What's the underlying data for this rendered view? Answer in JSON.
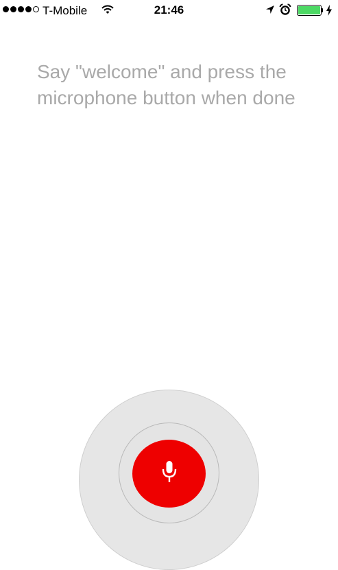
{
  "status_bar": {
    "signal_strength": 4,
    "signal_max": 5,
    "carrier": "T-Mobile",
    "time": "21:46",
    "battery_level": 1.0,
    "battery_color": "#4cd964",
    "icons": [
      "signal-dots-icon",
      "wifi-icon",
      "location-arrow-icon",
      "alarm-clock-icon",
      "battery-icon",
      "charging-bolt-icon"
    ]
  },
  "prompt": {
    "text": "Say \"welcome\" and press the microphone button when done",
    "color": "#a9a9a9"
  },
  "record_button": {
    "icon": "microphone-icon",
    "color": "#ee0000"
  }
}
